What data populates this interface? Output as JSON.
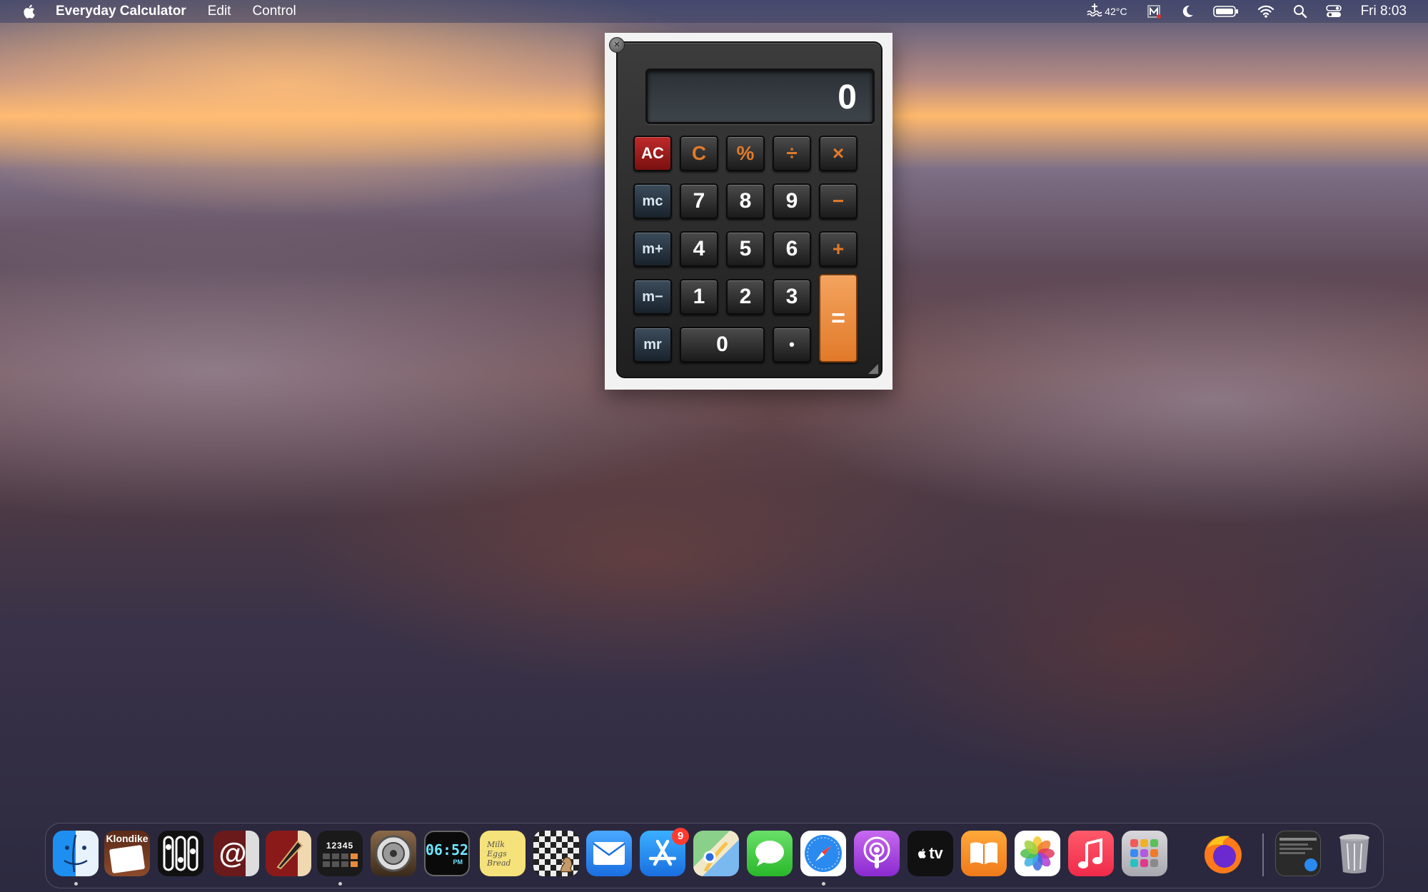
{
  "menubar": {
    "app_name": "Everyday Calculator",
    "menus": [
      "Edit",
      "Control"
    ],
    "temperature": "42°C",
    "clock": "Fri 8:03"
  },
  "calculator": {
    "display": "0",
    "keys": {
      "ac": "AC",
      "c": "C",
      "percent": "%",
      "divide": "÷",
      "multiply": "×",
      "mc": "mc",
      "seven": "7",
      "eight": "8",
      "nine": "9",
      "minus": "−",
      "mplus": "m+",
      "four": "4",
      "five": "5",
      "six": "6",
      "plus": "+",
      "mminus": "m−",
      "one": "1",
      "two": "2",
      "three": "3",
      "equals": "=",
      "mr": "mr",
      "zero": "0",
      "dot": "•"
    }
  },
  "dock": {
    "klondike_label": "Klondike",
    "calc_digits": "12345",
    "clock_time": "06:52",
    "clock_ampm": "PM",
    "notes_lines": [
      "Milk",
      "Eggs",
      "Bread"
    ],
    "app_store_badge": "9",
    "tv_label": "tv"
  }
}
